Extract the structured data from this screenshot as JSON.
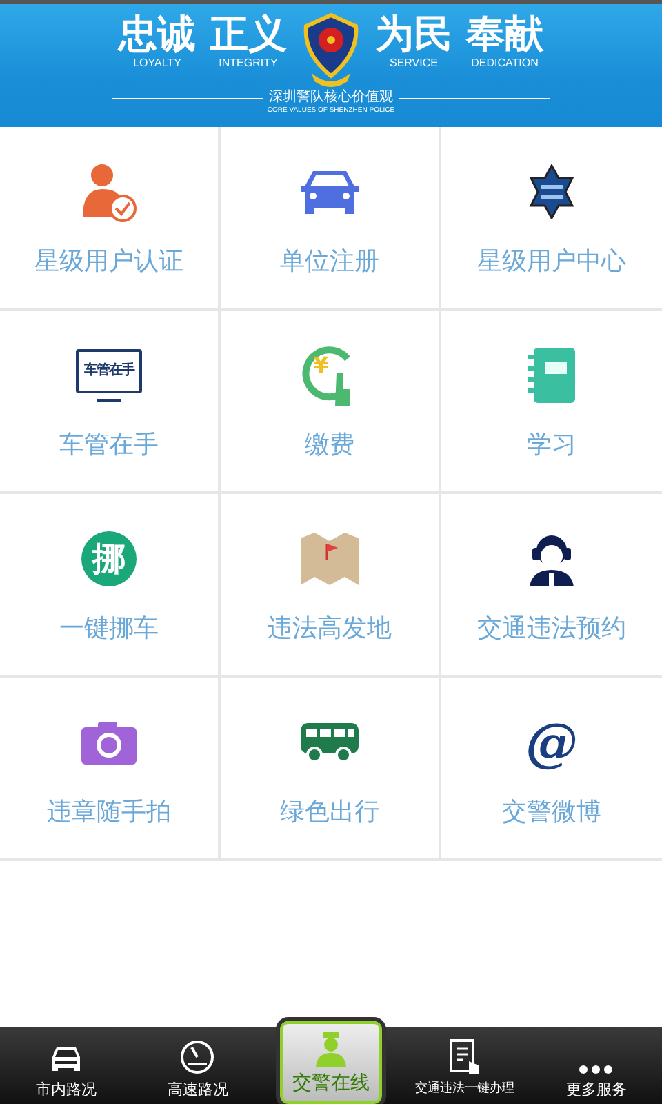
{
  "banner": {
    "slogans": [
      {
        "title": "忠诚",
        "subtitle": "LOYALTY"
      },
      {
        "title": "正义",
        "subtitle": "INTEGRITY"
      },
      {
        "title": "为民",
        "subtitle": "SERVICE"
      },
      {
        "title": "奉献",
        "subtitle": "DEDICATION"
      }
    ],
    "motto": "深圳警队核心价值观",
    "motto_en": "CORE VALUES OF SHENZHEN POLICE"
  },
  "tiles": [
    {
      "kind": "user-check",
      "label": "星级用户认证"
    },
    {
      "kind": "car",
      "label": "单位注册"
    },
    {
      "kind": "star-badge",
      "label": "星级用户中心"
    },
    {
      "kind": "monitor",
      "label": "车管在手",
      "icon_text": "车管在手"
    },
    {
      "kind": "pay",
      "label": "缴费",
      "icon_text": "¥"
    },
    {
      "kind": "notebook",
      "label": "学习"
    },
    {
      "kind": "circle-glyph",
      "label": "一键挪车",
      "icon_text": "挪"
    },
    {
      "kind": "map",
      "label": "违法高发地"
    },
    {
      "kind": "agent",
      "label": "交通违法预约"
    },
    {
      "kind": "camera",
      "label": "违章随手拍"
    },
    {
      "kind": "bus",
      "label": "绿色出行"
    },
    {
      "kind": "at",
      "label": "交警微博",
      "icon_text": "@"
    }
  ],
  "tabbar": [
    {
      "kind": "car",
      "label": "市内路况",
      "selected": false
    },
    {
      "kind": "gauge",
      "label": "高速路况",
      "selected": false
    },
    {
      "kind": "officer",
      "label": "交警在线",
      "selected": true
    },
    {
      "kind": "doc",
      "label": "交通违法一键办理",
      "selected": false
    },
    {
      "kind": "dots",
      "label": "更多服务",
      "selected": false
    }
  ]
}
